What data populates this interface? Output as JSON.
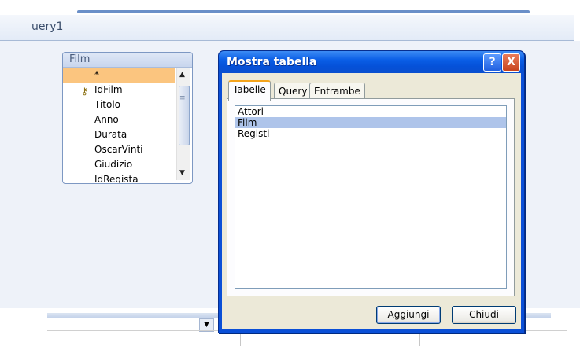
{
  "query_tab": {
    "label": "uery1"
  },
  "table_box": {
    "title": "Film",
    "fields": [
      "*",
      "IdFilm",
      "Titolo",
      "Anno",
      "Durata",
      "OscarVinti",
      "Giudizio",
      "IdRegista"
    ],
    "selected_index": 0,
    "key_field_index": 1
  },
  "icons": {
    "key": "key-icon",
    "scroll_up": "arrow-up-icon",
    "scroll_down": "arrow-down-icon",
    "grid_dropdown": "chevron-down-icon"
  },
  "dialog": {
    "title": "Mostra tabella",
    "help_label": "?",
    "close_label": "X",
    "tabs": [
      "Tabelle",
      "Query",
      "Entrambe"
    ],
    "active_tab": "Tabelle",
    "items": [
      "Attori",
      "Film",
      "Registi"
    ],
    "selected_item": "Film",
    "add_label": "Aggiungi",
    "close_button_label": "Chiudi"
  },
  "colors": {
    "title_bar": "#0a5ee6",
    "selection_orange": "#fbc57f",
    "selection_blue": "#aec4ea"
  }
}
